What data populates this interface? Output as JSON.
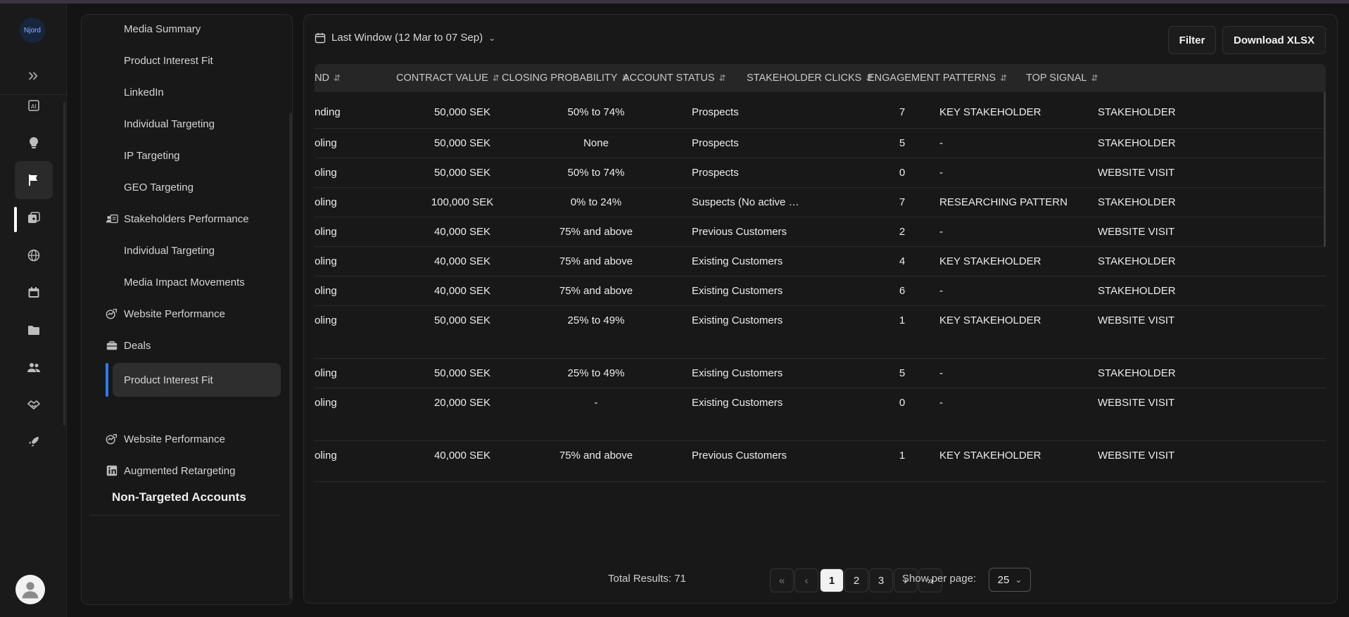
{
  "app": {
    "logo_text": "Njord"
  },
  "rail": {
    "icons": [
      "ai-icon",
      "lightbulb-icon",
      "flag-icon",
      "add-card-icon",
      "globe-icon",
      "calendar-icon",
      "folder-icon",
      "users-icon",
      "handshake-icon",
      "rocket-icon"
    ],
    "active": "flag-icon"
  },
  "sidenav": {
    "items": [
      {
        "label": "Media Summary",
        "icon": ""
      },
      {
        "label": "Product Interest Fit",
        "icon": ""
      },
      {
        "label": "LinkedIn",
        "icon": ""
      },
      {
        "label": "Individual Targeting",
        "icon": ""
      },
      {
        "label": "IP Targeting",
        "icon": ""
      },
      {
        "label": "GEO Targeting",
        "icon": ""
      },
      {
        "label": "Stakeholders Performance",
        "icon": "stakeholders-icon"
      },
      {
        "label": "Individual Targeting",
        "icon": ""
      },
      {
        "label": "Media Impact Movements",
        "icon": ""
      },
      {
        "label": "Website Performance",
        "icon": "website-performance-icon"
      },
      {
        "label": "Deals",
        "icon": "briefcase-icon"
      },
      {
        "label": "Product Interest Fit",
        "icon": "",
        "selected": true
      }
    ],
    "section_title": "Non-Targeted Accounts",
    "section_items": [
      {
        "label": "Website Performance",
        "icon": "website-performance-icon"
      },
      {
        "label": "Augmented Retargeting",
        "icon": "linkedin-icon"
      }
    ]
  },
  "toolbar": {
    "date_range": "Last Window (12 Mar to 07 Sep)",
    "filter_label": "Filter",
    "download_label": "Download XLSX"
  },
  "table": {
    "columns": [
      "ND",
      "CONTRACT VALUE",
      "CLOSING PROBABILITY",
      "ACCOUNT STATUS",
      "STAKEHOLDER CLICKS",
      "ENGAGEMENT PATTERNS",
      "TOP SIGNAL"
    ],
    "rows": [
      [
        "nding",
        "50,000 SEK",
        "50% to 74%",
        "Prospects",
        "7",
        "KEY STAKEHOLDER",
        "STAKEHOLDER"
      ],
      [
        "oling",
        "50,000 SEK",
        "None",
        "Prospects",
        "5",
        "-",
        "STAKEHOLDER"
      ],
      [
        "oling",
        "50,000 SEK",
        "50% to 74%",
        "Prospects",
        "0",
        "-",
        "WEBSITE VISIT"
      ],
      [
        "oling",
        "100,000 SEK",
        "0% to 24%",
        "Suspects (No active dea…",
        "7",
        "RESEARCHING PATTERN",
        "STAKEHOLDER"
      ],
      [
        "oling",
        "40,000 SEK",
        "75% and above",
        "Previous Customers",
        "2",
        "-",
        "WEBSITE VISIT"
      ],
      [
        "oling",
        "40,000 SEK",
        "75% and above",
        "Existing Customers",
        "4",
        "KEY STAKEHOLDER",
        "STAKEHOLDER"
      ],
      [
        "oling",
        "40,000 SEK",
        "75% and above",
        "Existing Customers",
        "6",
        "-",
        "STAKEHOLDER"
      ],
      [
        "oling",
        "50,000 SEK",
        "25% to 49%",
        "Existing Customers",
        "1",
        "KEY STAKEHOLDER",
        "WEBSITE VISIT"
      ],
      [
        "oling",
        "50,000 SEK",
        "25% to 49%",
        "Existing Customers",
        "5",
        "-",
        "STAKEHOLDER"
      ],
      [
        "oling",
        "20,000 SEK",
        "-",
        "Existing Customers",
        "0",
        "-",
        "WEBSITE VISIT"
      ],
      [
        "oling",
        "40,000 SEK",
        "75% and above",
        "Previous Customers",
        "1",
        "KEY STAKEHOLDER",
        "WEBSITE VISIT"
      ]
    ]
  },
  "pagination": {
    "total_label": "Total Results: 71",
    "pages": [
      "1",
      "2",
      "3"
    ],
    "current_page": "1",
    "per_page_label": "Show per page:",
    "per_page_value": "25"
  },
  "colors": {
    "accent": "#2f7bf0",
    "background": "#141414",
    "panel": "#181818"
  }
}
